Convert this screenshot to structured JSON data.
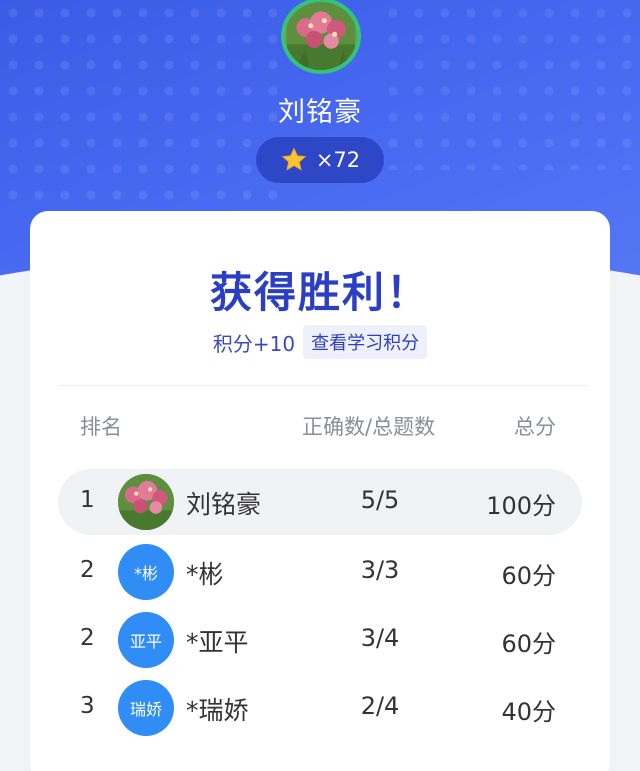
{
  "user": {
    "name": "刘铭豪",
    "avatar": "flower-photo",
    "stars": "×72"
  },
  "result": {
    "title": "获得胜利！",
    "points": "积分+10",
    "view_points_label": "查看学习积分"
  },
  "table": {
    "headers": {
      "rank": "排名",
      "ratio": "正确数/总题数",
      "total": "总分"
    },
    "rows": [
      {
        "rank": "1",
        "avatar_text": "",
        "avatar": "flower-photo",
        "name": "刘铭豪",
        "ratio": "5/5",
        "score": "100分",
        "highlight": true
      },
      {
        "rank": "2",
        "avatar_text": "*彬",
        "name": "*彬",
        "ratio": "3/3",
        "score": "60分"
      },
      {
        "rank": "2",
        "avatar_text": "亚平",
        "name": "*亚平",
        "ratio": "3/4",
        "score": "60分"
      },
      {
        "rank": "3",
        "avatar_text": "瑞娇",
        "name": "*瑞娇",
        "ratio": "2/4",
        "score": "40分"
      }
    ]
  },
  "colors": {
    "hero": "#4a6cf2",
    "accent": "#2b3fc4",
    "avatar_blue": "#2f8df5",
    "star": "#f7c531"
  }
}
